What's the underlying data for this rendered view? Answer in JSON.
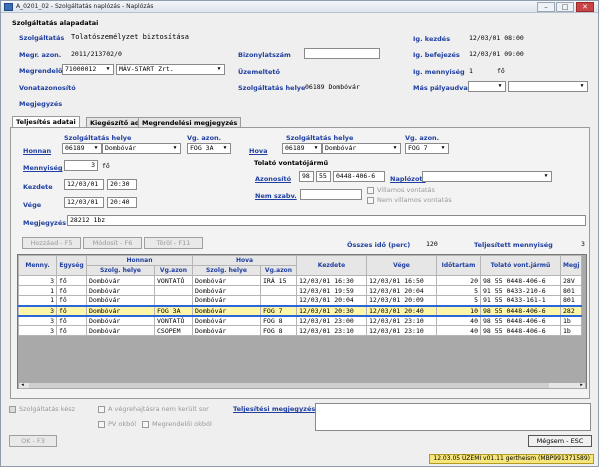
{
  "window": {
    "title": "A_0201_02 - Szolgáltatás naplózás - Naplózás",
    "minimize": "–",
    "maximize": "□",
    "close": "✕"
  },
  "header": {
    "section_title": "Szolgáltatás alapadatai",
    "szolgaltatas_label": "Szolgáltatás",
    "szolgaltatas_value": "Tolatószemélyzet biztosítása",
    "megr_azon_label": "Megr. azon.",
    "megr_azon_value": "2011/213702/0",
    "megrendelo_label": "Megrendelő",
    "megrendelo_code": "71000012",
    "megrendelo_name": "MÁV-START Zrt.",
    "vonatazonosito_label": "Vonatazonosító",
    "megjegyzes_label": "Megjegyzés",
    "bizonylatszam_label": "Bizonylatszám",
    "bizonylatszam_value": "",
    "uzemelteto_label": "Üzemeltető",
    "szolg_helye_label": "Szolgáltatás helye",
    "szolg_helye_value": "06189 Dombóvár",
    "lg_kezdes_label": "Ig. kezdés",
    "lg_kezdes_value": "12/03/01 08:00",
    "lg_befejezes_label": "Ig. befejezés",
    "lg_befejezes_value": "12/03/01 09:00",
    "lg_mennyiseg_label": "Ig. mennyiség",
    "lg_mennyiseg_value": "1",
    "lg_mennyiseg_unit": "fő",
    "mas_palyaudvar_label": "Más pályaudvar",
    "mas_palyaudvar_value": ""
  },
  "tabs": [
    {
      "label": "Teljesítés adatai"
    },
    {
      "label": "Kiegészítő adatok"
    },
    {
      "label": "Megrendelési megjegyzés"
    }
  ],
  "form": {
    "honnan_label": "Honnan",
    "szolg_helye_header": "Szolgáltatás helye",
    "vg_azon_header": "Vg. azon.",
    "honnan_code": "06189",
    "honnan_place": "Dombóvár",
    "honnan_vg": "FOG 3A",
    "hova_label": "Hova",
    "hova_code": "06189",
    "hova_place": "Dombóvár",
    "hova_vg": "FOG 7",
    "mennyiseg_label": "Mennyiség",
    "mennyiseg_value": "3",
    "mennyiseg_unit": "fő",
    "kezdete_label": "Kezdete",
    "kezdete_date": "12/03/01",
    "kezdete_time": "20:30",
    "vege_label": "Vége",
    "vege_date": "12/03/01",
    "vege_time": "20:40",
    "tolato_title": "Tolató vontatójármű",
    "azonosito_label": "Azonosító",
    "azonosito_a": "98",
    "azonosito_b": "55",
    "azonosito_c": "0448-406-6",
    "naplozott_label": "Naplózott",
    "naplozott_value": "",
    "nem_szabv_label": "Nem szabv.",
    "villamos_label": "Villamos vontatás",
    "nem_villamos_label": "Nem villamos vontatás",
    "megjegyzes_label": "Megjegyzés",
    "megjegyzes_value": "28212 1bz"
  },
  "actions": {
    "hozzaad": "Hozzáad - F5",
    "modosit": "Módosít - F6",
    "torol": "Töröl - F11",
    "osszes_ido_label": "Összes idő (perc)",
    "osszes_ido_value": "120",
    "teljesitett_label": "Teljesített mennyiség",
    "teljesitett_value": "3"
  },
  "grid": {
    "headers": {
      "menny": "Menny.",
      "egyseg": "Egység",
      "honnan": "Honnan",
      "hova": "Hova",
      "szolg_helye": "Szolg. helye",
      "vg_azon": "Vg.azon",
      "kezdete": "Kezdete",
      "vege": "Vége",
      "idotartam": "Időtartam",
      "tolato": "Tolató vont.jármű",
      "megj": "Megj"
    },
    "rows": [
      {
        "menny": "3",
        "egyseg": "fő",
        "h_place": "Dombóvár",
        "h_vg": "VONTATÓ",
        "v_place": "Dombóvár",
        "v_vg": "IRÁ 15",
        "kezd": "12/03/01 16:30",
        "vege": "12/03/01 16:50",
        "ido": "20",
        "vont": "98 55 0448-406-6",
        "megj": "28V"
      },
      {
        "menny": "1",
        "egyseg": "fő",
        "h_place": "Dombóvár",
        "h_vg": "",
        "v_place": "Dombóvár",
        "v_vg": "",
        "kezd": "12/03/01 19:59",
        "vege": "12/03/01 20:04",
        "ido": "5",
        "vont": "91 55 0433-210-6",
        "megj": "801"
      },
      {
        "menny": "1",
        "egyseg": "fő",
        "h_place": "Dombóvár",
        "h_vg": "",
        "v_place": "Dombóvár",
        "v_vg": "",
        "kezd": "12/03/01 20:04",
        "vege": "12/03/01 20:09",
        "ido": "5",
        "vont": "91 55 0433-161-1",
        "megj": "801"
      },
      {
        "menny": "3",
        "egyseg": "fő",
        "h_place": "Dombóvár",
        "h_vg": "FOG 3A",
        "v_place": "Dombóvár",
        "v_vg": "FOG 7",
        "kezd": "12/03/01 20:30",
        "vege": "12/03/01 20:40",
        "ido": "10",
        "vont": "98 55 0448-406-6",
        "megj": "282"
      },
      {
        "menny": "3",
        "egyseg": "fő",
        "h_place": "Dombóvár",
        "h_vg": "VONTATÓ",
        "v_place": "Dombóvár",
        "v_vg": "FOG 8",
        "kezd": "12/03/01 23:00",
        "vege": "12/03/01 23:10",
        "ido": "40",
        "vont": "98 55 0448-406-6",
        "megj": "1b"
      },
      {
        "menny": "3",
        "egyseg": "fő",
        "h_place": "Dombóvár",
        "h_vg": "CSOPEM",
        "v_place": "Dombóvár",
        "v_vg": "FOG 8",
        "kezd": "12/03/01 23:10",
        "vege": "12/03/01 23:10",
        "ido": "40",
        "vont": "98 55 0448-406-6",
        "megj": "1b"
      }
    ]
  },
  "footer": {
    "kesz_label": "Szolgáltatás kész",
    "vegrehajtasra_label": "A végrehajtásra nem került sor",
    "pv_oktol_label": "PV okból",
    "megrendeloi_label": "Megrendelői okból",
    "teljesitesi_megj_label": "Teljesítési megjegyzés",
    "ok_button": "OK - F3",
    "megsem_button": "Mégsem - ESC",
    "status_text": "12.03.05 ÜZEMI v01.11 gertheism (MBP991371589)"
  }
}
